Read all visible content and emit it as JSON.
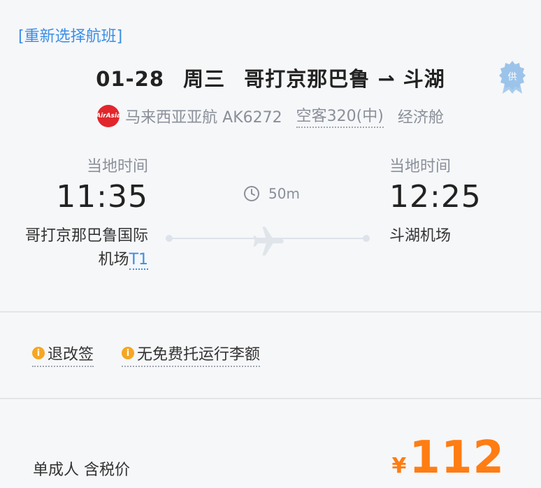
{
  "header": {
    "reselect_label": "[重新选择航班]"
  },
  "flight": {
    "date": "01-28",
    "weekday": "周三",
    "route": "哥打京那巴鲁 ⇀ 斗湖",
    "badge_text": "供",
    "airline_logo_text": "AirAsia",
    "airline": "马来西亚亚航 AK6272",
    "aircraft": "空客320(中)",
    "cabin": "经济舱"
  },
  "departure": {
    "label": "当地时间",
    "time": "11:35",
    "airport_line1": "哥打京那巴鲁国际",
    "airport_line2": "机场",
    "terminal": "T1"
  },
  "arrival": {
    "label": "当地时间",
    "time": "12:25",
    "airport": "斗湖机场"
  },
  "duration": "50m",
  "rules": [
    {
      "label": "退改签"
    },
    {
      "label": "无免费托运行李额"
    }
  ],
  "pricing": {
    "passenger_label": "单成人 含税价",
    "currency": "¥",
    "amount": "112"
  },
  "colors": {
    "accent": "#3a8ee6",
    "price": "#ff7d13",
    "info": "#f5a623",
    "airline": "#e1262c"
  }
}
